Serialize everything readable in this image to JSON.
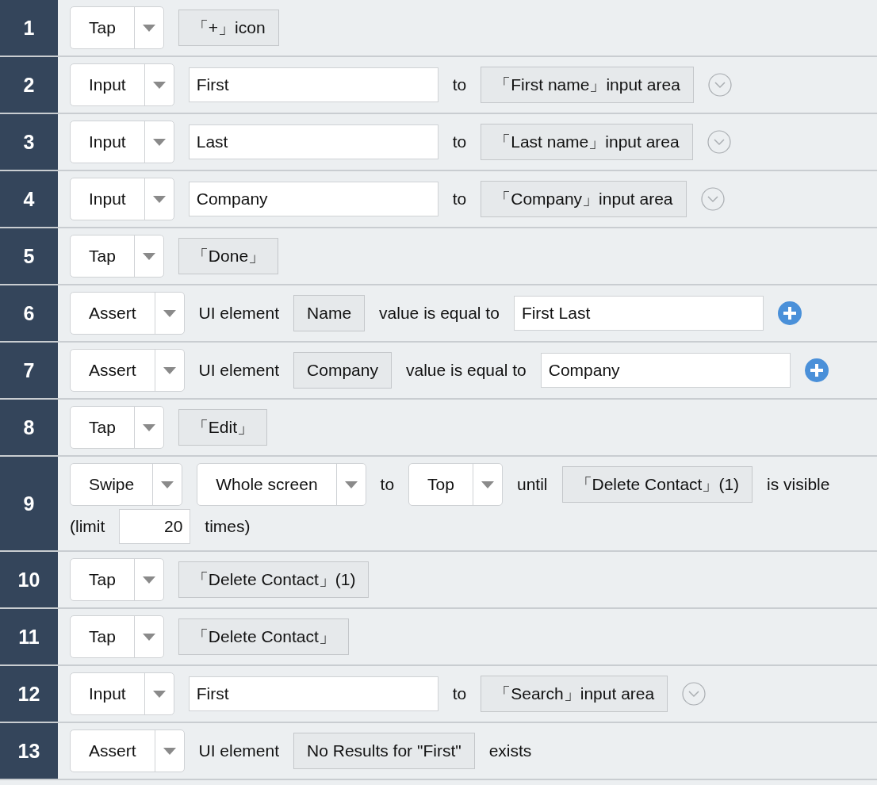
{
  "steps": [
    {
      "number": "1",
      "lines": [
        [
          {
            "kind": "select",
            "value": "Tap"
          },
          {
            "kind": "target",
            "label": "「+」icon"
          }
        ]
      ]
    },
    {
      "number": "2",
      "lines": [
        [
          {
            "kind": "select",
            "value": "Input"
          },
          {
            "kind": "input",
            "value": "First"
          },
          {
            "kind": "text",
            "text": "to"
          },
          {
            "kind": "target",
            "label": "「First name」input area"
          },
          {
            "kind": "expand"
          }
        ]
      ]
    },
    {
      "number": "3",
      "lines": [
        [
          {
            "kind": "select",
            "value": "Input"
          },
          {
            "kind": "input",
            "value": "Last"
          },
          {
            "kind": "text",
            "text": "to"
          },
          {
            "kind": "target",
            "label": "「Last name」input area"
          },
          {
            "kind": "expand"
          }
        ]
      ]
    },
    {
      "number": "4",
      "lines": [
        [
          {
            "kind": "select",
            "value": "Input"
          },
          {
            "kind": "input",
            "value": "Company"
          },
          {
            "kind": "text",
            "text": "to"
          },
          {
            "kind": "target",
            "label": "「Company」input area"
          },
          {
            "kind": "expand"
          }
        ]
      ]
    },
    {
      "number": "5",
      "lines": [
        [
          {
            "kind": "select",
            "value": "Tap"
          },
          {
            "kind": "target",
            "label": "「Done」"
          }
        ]
      ]
    },
    {
      "number": "6",
      "lines": [
        [
          {
            "kind": "select",
            "value": "Assert"
          },
          {
            "kind": "text",
            "text": "UI element"
          },
          {
            "kind": "target",
            "label": "Name"
          },
          {
            "kind": "text",
            "text": "value is equal to"
          },
          {
            "kind": "input",
            "value": "First Last"
          },
          {
            "kind": "add"
          }
        ]
      ]
    },
    {
      "number": "7",
      "lines": [
        [
          {
            "kind": "select",
            "value": "Assert"
          },
          {
            "kind": "text",
            "text": "UI element"
          },
          {
            "kind": "target",
            "label": "Company"
          },
          {
            "kind": "text",
            "text": "value is equal to"
          },
          {
            "kind": "input",
            "value": "Company"
          },
          {
            "kind": "add"
          }
        ]
      ]
    },
    {
      "number": "8",
      "lines": [
        [
          {
            "kind": "select",
            "value": "Tap"
          },
          {
            "kind": "target",
            "label": "「Edit」"
          }
        ]
      ]
    },
    {
      "number": "9",
      "lines": [
        [
          {
            "kind": "select",
            "value": "Swipe"
          },
          {
            "kind": "select",
            "value": "Whole screen"
          },
          {
            "kind": "text",
            "text": "to"
          },
          {
            "kind": "select",
            "value": "Top"
          },
          {
            "kind": "text",
            "text": "until"
          },
          {
            "kind": "target",
            "label": "「Delete Contact」(1)"
          },
          {
            "kind": "text",
            "text": "is visible"
          }
        ],
        [
          {
            "kind": "text",
            "text": "(limit"
          },
          {
            "kind": "count",
            "value": "20"
          },
          {
            "kind": "text",
            "text": "times)"
          }
        ]
      ]
    },
    {
      "number": "10",
      "lines": [
        [
          {
            "kind": "select",
            "value": "Tap"
          },
          {
            "kind": "target",
            "label": "「Delete Contact」(1)"
          }
        ]
      ]
    },
    {
      "number": "11",
      "lines": [
        [
          {
            "kind": "select",
            "value": "Tap"
          },
          {
            "kind": "target",
            "label": "「Delete Contact」"
          }
        ]
      ]
    },
    {
      "number": "12",
      "lines": [
        [
          {
            "kind": "select",
            "value": "Input"
          },
          {
            "kind": "input",
            "value": "First"
          },
          {
            "kind": "text",
            "text": "to"
          },
          {
            "kind": "target",
            "label": "「Search」input area"
          },
          {
            "kind": "expand"
          }
        ]
      ]
    },
    {
      "number": "13",
      "lines": [
        [
          {
            "kind": "select",
            "value": "Assert"
          },
          {
            "kind": "text",
            "text": "UI element"
          },
          {
            "kind": "target",
            "label": "No Results for \"First\""
          },
          {
            "kind": "text",
            "text": "exists"
          }
        ]
      ]
    }
  ]
}
